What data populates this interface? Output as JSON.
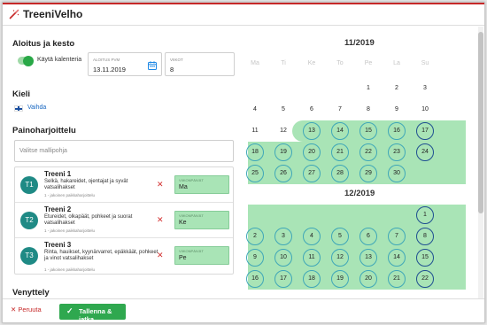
{
  "app": {
    "title": "TreeniVelho"
  },
  "start": {
    "heading": "Aloitus ja kesto",
    "toggle_label": "Käytä kalenteria",
    "date_label": "ALOITUS PVM",
    "date_value": "13.11.2019",
    "weeks_label": "VIIKOT",
    "weeks_value": "8"
  },
  "language": {
    "heading": "Kieli",
    "change_label": "Vaihda"
  },
  "workouts": {
    "heading": "Painoharjoittelu",
    "template_placeholder": "Valitse mallipohja",
    "weekday_label": "VIIKONPÄIVÄT",
    "items": [
      {
        "avatar": "T1",
        "title": "Treeni 1",
        "desc": "Selkä, hakareidet, ojentajat ja syvät vatsalihakset",
        "sub": "1 - jakoinen paikkaharjoittelu",
        "day": "Ma"
      },
      {
        "avatar": "T2",
        "title": "Treeni 2",
        "desc": "Etureidet, olkapäät, pohkeet ja suorat vatsalihakset",
        "sub": "1 - jakoinen paikkaharjoittelu",
        "day": "Ke"
      },
      {
        "avatar": "T3",
        "title": "Treeni 3",
        "desc": "Rinta, hauikset, kyynärvarret, epäkkäät, pohkeet ja vinot vatsalihakset",
        "sub": "1 - jakoinen paikkaharjoittelu",
        "day": "Pe"
      }
    ]
  },
  "stretch": {
    "heading": "Venyttely"
  },
  "calendar": {
    "weekdays": [
      "Ma",
      "Ti",
      "Ke",
      "To",
      "Pe",
      "La",
      "Su"
    ],
    "months": [
      {
        "title": "11/2019",
        "weeks": [
          [
            "",
            "",
            "",
            "",
            "1",
            "2",
            "3"
          ],
          [
            "4",
            "5",
            "6",
            "7",
            "8",
            "9",
            "10"
          ],
          [
            "11",
            "12",
            "13",
            "14",
            "15",
            "16",
            "17"
          ],
          [
            "18",
            "19",
            "20",
            "21",
            "22",
            "23",
            "24"
          ],
          [
            "25",
            "26",
            "27",
            "28",
            "29",
            "30",
            ""
          ]
        ]
      },
      {
        "title": "12/2019",
        "weeks": [
          [
            "",
            "",
            "",
            "",
            "",
            "",
            "1"
          ],
          [
            "2",
            "3",
            "4",
            "5",
            "6",
            "7",
            "8"
          ],
          [
            "9",
            "10",
            "11",
            "12",
            "13",
            "14",
            "15"
          ],
          [
            "16",
            "17",
            "18",
            "19",
            "20",
            "21",
            "22"
          ]
        ]
      }
    ]
  },
  "footer": {
    "cancel_label": "Peruuta",
    "save_label": "Tallenna & jatka"
  },
  "colors": {
    "accent_red": "#c62828",
    "brand_green": "#2fa84f",
    "highlight_green": "#a9e4b6",
    "avatar_teal": "#1f8a85",
    "week_start_blue": "#1f4f91"
  },
  "icons": {
    "logo": "wand-icon",
    "date": "calendar-icon",
    "remove": "close-icon",
    "save": "check-icon",
    "language": "finland-flag-icon"
  }
}
